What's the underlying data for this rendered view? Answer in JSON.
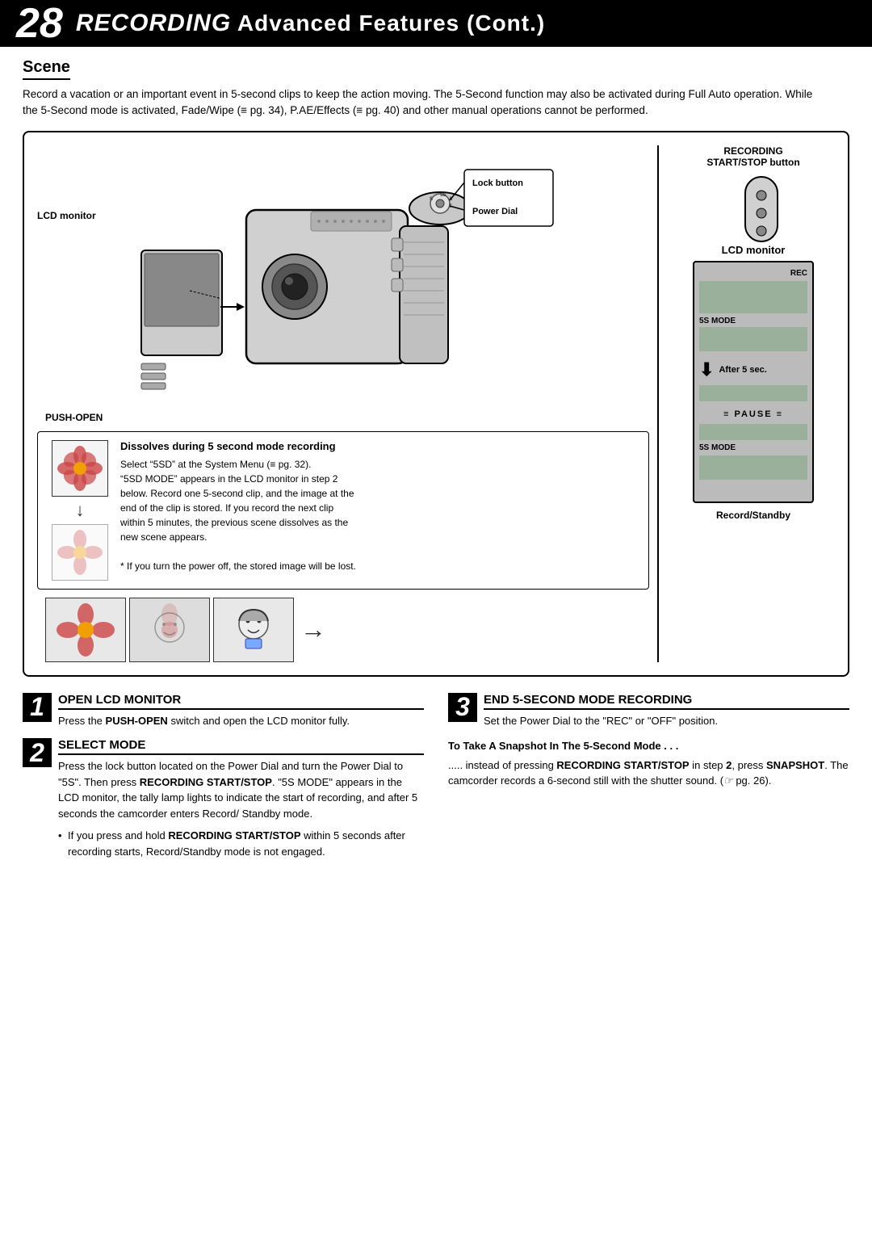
{
  "header": {
    "page_number": "28",
    "title_italic": "RECORDING",
    "title_regular": " Advanced Features (Cont.)"
  },
  "scene": {
    "heading": "Scene",
    "description": "Record a vacation or an important event in 5-second clips to keep the action moving. The 5-Second function may also be activated during Full Auto operation. While the 5-Second mode is activated, Fade/Wipe (≡ pg. 34), P.AE/Effects (≡ pg. 40) and other manual operations cannot be performed."
  },
  "diagram": {
    "lcd_monitor_left_label": "LCD monitor",
    "push_open_label": "PUSH-OPEN",
    "lock_button_label": "Lock button",
    "power_dial_label": "Power Dial",
    "recording_start_stop_label": "RECORDING\nSTART/STOP button",
    "lcd_monitor_right_label": "LCD monitor",
    "rec_text": "REC",
    "5s_mode_top": "5S MODE",
    "after_5sec_label": "After 5 sec.",
    "pause_label": "≡ PAUSE ≡",
    "5s_mode_bottom": "5S MODE",
    "record_standby_label": "Record/Standby"
  },
  "dissolves": {
    "title": "Dissolves during 5 second mode recording",
    "body_line1": "Select “5SD” at the System Menu (≡ pg. 32).",
    "body_line2": "“5SD MODE” appears in the LCD monitor in step 2",
    "body_line3": "below. Record one 5-second clip, and the image at the",
    "body_line4": "end of the clip is stored. If you record the next clip",
    "body_line5": "within 5 minutes, the previous scene dissolves as the",
    "body_line6": "new scene appears.",
    "body_note": "* If you turn the power off, the stored image will be lost."
  },
  "steps": {
    "step1": {
      "number": "1",
      "title": "OPEN LCD MONITOR",
      "body": "Press the PUSH-OPEN switch and open the LCD monitor fully."
    },
    "step2": {
      "number": "2",
      "title": "SELECT MODE",
      "body1": "Press the lock button located on the Power Dial and turn the Power Dial to “5S”. Then press RECORDING START/STOP. “5S MODE” appears in the LCD monitor, the tally lamp lights to indicate the start of recording, and after 5 seconds the camcorder enters Record/Standby mode.",
      "bullet": "If you press and hold RECORDING START/STOP within 5 seconds after recording starts, Record/Standby mode is not engaged."
    },
    "step3": {
      "number": "3",
      "title": "END 5-SECOND MODE RECORDING",
      "body": "Set the Power Dial to the “REC” or “OFF” position."
    },
    "snapshot_title": "To Take A Snapshot In The 5-Second Mode . . .",
    "snapshot_body": "..... instead of pressing RECORDING START/STOP in step 2, press SNAPSHOT. The camcorder records a 6-second still with the shutter sound. (≡ pg. 26)."
  }
}
